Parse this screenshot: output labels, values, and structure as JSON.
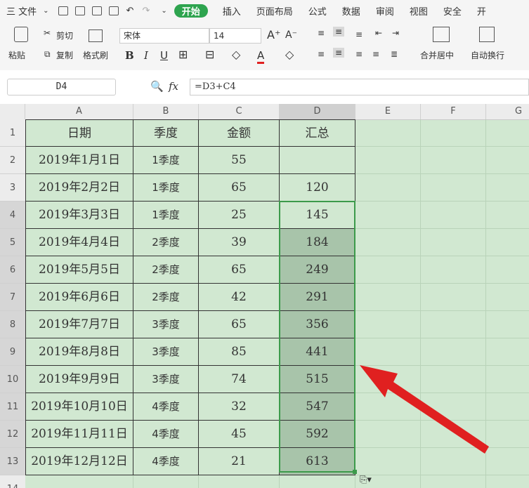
{
  "menubar": {
    "file_label": "三 文件",
    "tabs": [
      "开始",
      "插入",
      "页面布局",
      "公式",
      "数据",
      "审阅",
      "视图",
      "安全",
      "开"
    ]
  },
  "ribbon": {
    "paste": "粘贴",
    "cut": "剪切",
    "copy": "复制",
    "format_painter": "格式刷",
    "font_name": "宋体",
    "font_size": "14",
    "merge_center": "合并居中",
    "wrap_text": "自动换行"
  },
  "formula_bar": {
    "name_box": "D4",
    "fx": "fx",
    "formula": "=D3+C4"
  },
  "sheet": {
    "columns": [
      "A",
      "B",
      "C",
      "D",
      "E",
      "F",
      "G"
    ],
    "rows": [
      [
        "日期",
        "季度",
        "金额",
        "汇总"
      ],
      [
        "2019年1月1日",
        "1季度",
        "55",
        ""
      ],
      [
        "2019年2月2日",
        "1季度",
        "65",
        "120"
      ],
      [
        "2019年3月3日",
        "1季度",
        "25",
        "145"
      ],
      [
        "2019年4月4日",
        "2季度",
        "39",
        "184"
      ],
      [
        "2019年5月5日",
        "2季度",
        "65",
        "249"
      ],
      [
        "2019年6月6日",
        "2季度",
        "42",
        "291"
      ],
      [
        "2019年7月7日",
        "3季度",
        "65",
        "356"
      ],
      [
        "2019年8月8日",
        "3季度",
        "85",
        "441"
      ],
      [
        "2019年9月9日",
        "3季度",
        "74",
        "515"
      ],
      [
        "2019年10月10日",
        "4季度",
        "32",
        "547"
      ],
      [
        "2019年11月11日",
        "4季度",
        "45",
        "592"
      ],
      [
        "2019年12月12日",
        "4季度",
        "21",
        "613"
      ]
    ],
    "row_numbers": [
      "1",
      "2",
      "3",
      "4",
      "5",
      "6",
      "7",
      "8",
      "9",
      "10",
      "11",
      "12",
      "13",
      "14"
    ]
  },
  "colors": {
    "grid_bg": "#d1e8d1",
    "selection": "#a8c4aa",
    "accent_green": "#2ea44f",
    "arrow": "#e02020"
  }
}
